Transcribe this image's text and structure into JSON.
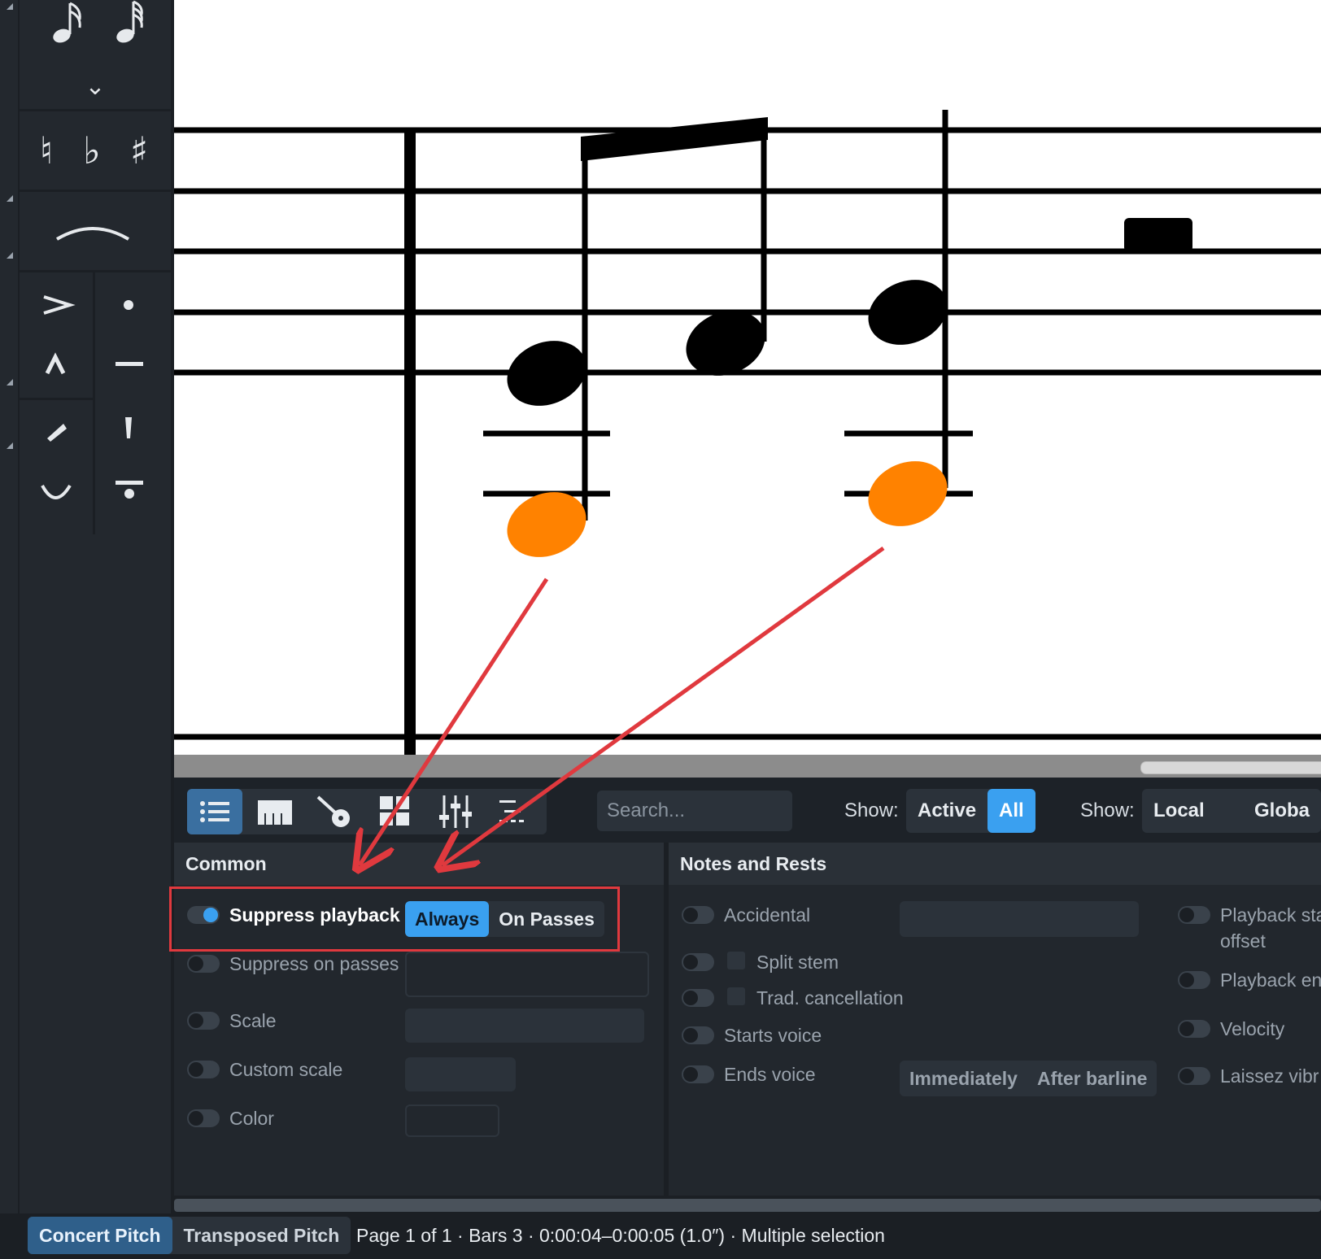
{
  "palette": {
    "chevron_glyph": "⌄",
    "accidentals": [
      "♮",
      "♭",
      "♯"
    ],
    "articulations": [
      ">",
      "•",
      "^",
      "—"
    ],
    "tie_glyph": "⌒"
  },
  "properties_toolbar": {
    "icons": [
      "list-icon",
      "piano-keys-icon",
      "guitar-icon",
      "grid-icon",
      "sliders-icon",
      "layout-icon"
    ],
    "search_placeholder": "Search...",
    "show1_label": "Show:",
    "show1_options": [
      "Active",
      "All"
    ],
    "show1_selected": "All",
    "show2_label": "Show:",
    "show2_options": [
      "Local Only",
      "Globa"
    ],
    "show2_selected": "Local Only"
  },
  "common_panel": {
    "title": "Common",
    "rows": [
      {
        "label": "Suppress playback",
        "active": true
      },
      {
        "label": "Suppress on passes",
        "active": false
      },
      {
        "label": "Scale",
        "active": false
      },
      {
        "label": "Custom scale",
        "active": false
      },
      {
        "label": "Color",
        "active": false
      }
    ],
    "suppress_options": [
      "Always",
      "On Passes"
    ],
    "suppress_selected": "Always"
  },
  "notes_panel": {
    "title": "Notes and Rests",
    "left_rows": [
      {
        "label": "Accidental"
      },
      {
        "label": "Split stem"
      },
      {
        "label": "Trad. cancellation"
      },
      {
        "label": "Starts voice"
      },
      {
        "label": "Ends voice"
      }
    ],
    "ends_voice_options": [
      "Immediately",
      "After barline"
    ],
    "right_rows": [
      {
        "label": "Playback sta",
        "label2": "offset"
      },
      {
        "label": "Playback en"
      },
      {
        "label": "Velocity"
      },
      {
        "label": "Laissez vibr"
      }
    ]
  },
  "status_bar": {
    "pitch_options": [
      "Concert Pitch",
      "Transposed Pitch"
    ],
    "pitch_selected": "Concert Pitch",
    "status_text": "Page 1 of 1 · Bars 3 · 0:00:04–0:00:05 (1.0″) · Multiple selection"
  },
  "colors": {
    "accent": "#3aa0f0",
    "highlighted_note": "#ff8200",
    "annotation": "#e0393e"
  }
}
